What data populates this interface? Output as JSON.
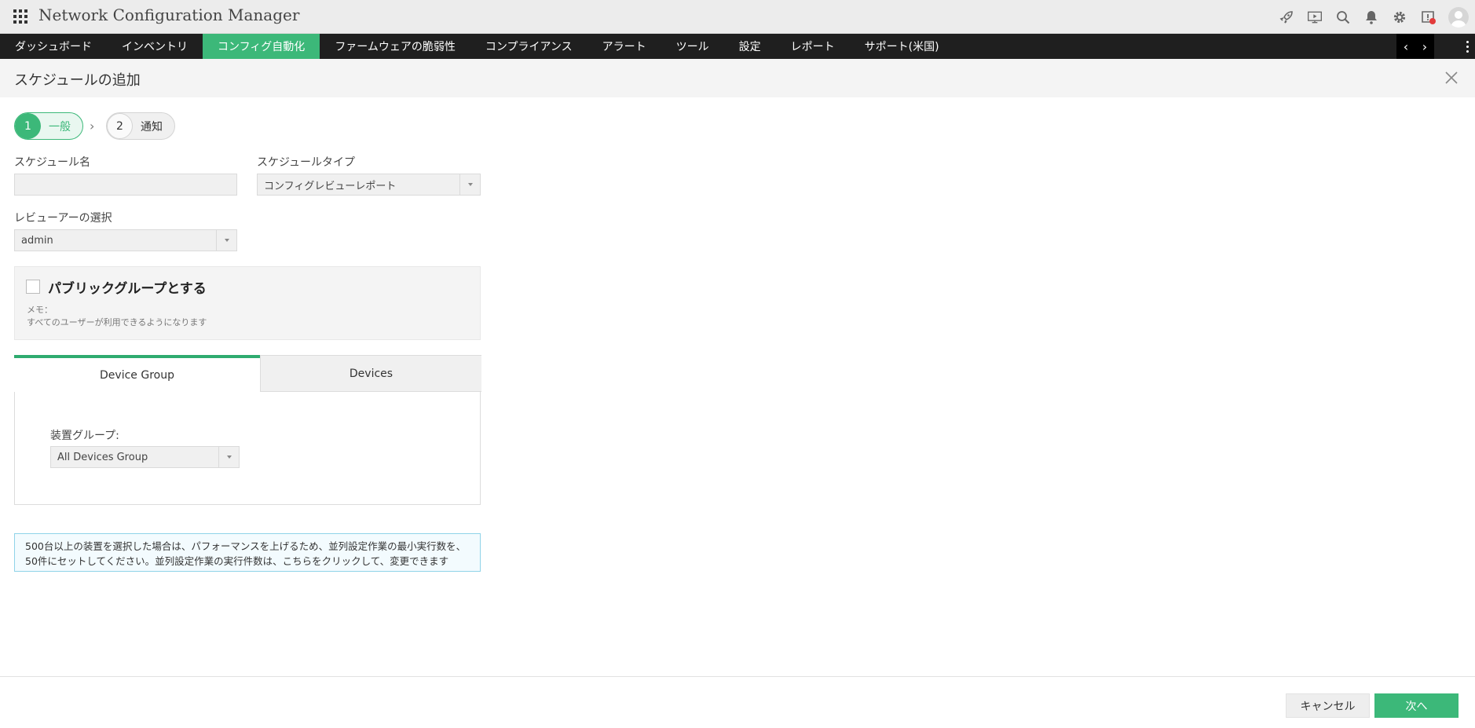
{
  "app": {
    "title": "Network Configuration Manager"
  },
  "nav": {
    "items": [
      "ダッシュボード",
      "インベントリ",
      "コンフィグ自動化",
      "ファームウェアの脆弱性",
      "コンプライアンス",
      "アラート",
      "ツール",
      "設定",
      "レポート",
      "サポート(米国)"
    ],
    "active_index": 2,
    "prev": "‹",
    "next": "›"
  },
  "page": {
    "title": "スケジュールの追加"
  },
  "steps": [
    {
      "num": "1",
      "label": "一般"
    },
    {
      "num": "2",
      "label": "通知"
    }
  ],
  "form": {
    "schedule_name": {
      "label": "スケジュール名",
      "value": ""
    },
    "schedule_type": {
      "label": "スケジュールタイプ",
      "value": "コンフィグレビューレポート"
    },
    "reviewer": {
      "label": "レビューアーの選択",
      "value": "admin"
    },
    "public_group": {
      "label": "パブリックグループとする",
      "memo_label": "メモ：",
      "memo_text": "すべてのユーザーが利用できるようになります",
      "checked": false
    }
  },
  "tabs": {
    "device_group": "Device Group",
    "devices": "Devices",
    "group_label": "装置グループ:",
    "group_value": "All Devices Group"
  },
  "info": {
    "line1": "500台以上の装置を選択した場合は、パフォーマンスを上げるため、並列設定作業の最小実行数を、",
    "line2": "50件にセットしてください。並列設定作業の実行件数は、こちらをクリックして、変更できます"
  },
  "footer": {
    "cancel": "キャンセル",
    "next": "次へ"
  },
  "colors": {
    "accent": "#3cb879",
    "nav_bg": "#1f1f1f",
    "alert": "#e23b3b"
  }
}
